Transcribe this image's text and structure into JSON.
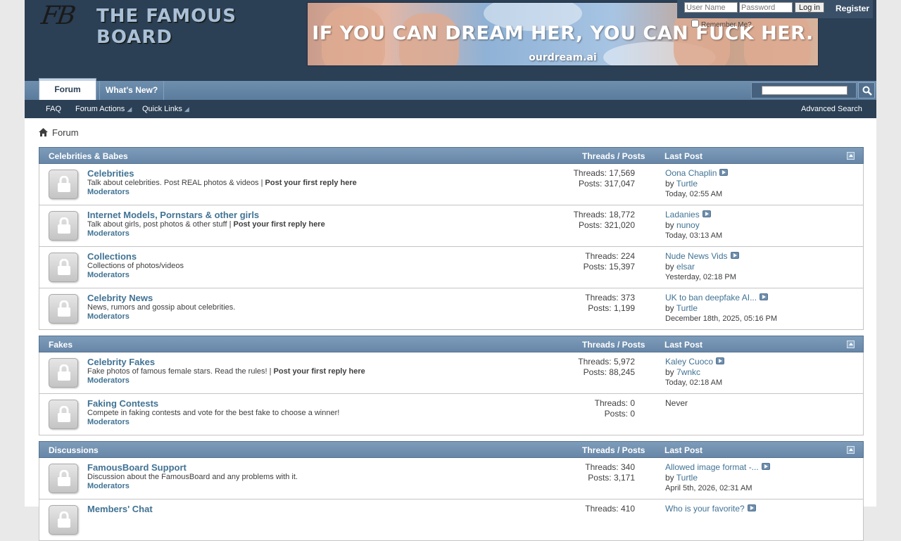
{
  "header": {
    "logo_mark": "FB",
    "logo_text": "THE FAMOUS BOARD",
    "banner_headline": "IF YOU CAN DREAM HER, YOU CAN FUCK HER.",
    "banner_domain": "ourdream.ai"
  },
  "login": {
    "username_placeholder": "User Name",
    "password_placeholder": "Password",
    "login_button": "Log in",
    "register": "Register",
    "remember_me": "Remember Me?"
  },
  "nav": {
    "tabs": [
      "Forum",
      "What's New?"
    ],
    "sub_links": [
      "FAQ",
      "Forum Actions",
      "Quick Links"
    ],
    "advanced_search": "Advanced Search"
  },
  "breadcrumb": "Forum",
  "categories": [
    {
      "title": "Celebrities & Babes",
      "threads_posts": "Threads / Posts",
      "last_post": "Last Post",
      "forums": [
        {
          "title": "Celebrities",
          "desc": "Talk about celebrities. Post REAL photos & videos | ",
          "desc_bold": "Post your first reply here",
          "mods": "Moderators",
          "threads": "Threads: 17,569",
          "posts": "Posts: 317,047",
          "lp_title": "Oona Chaplin",
          "lp_by": "by ",
          "lp_user": "Turtle",
          "lp_date": "Today, ",
          "lp_time": "02:55 AM"
        },
        {
          "title": "Internet Models, Pornstars & other girls",
          "desc": "Talk about girls, post photos & other stuff | ",
          "desc_bold": "Post your first reply here",
          "mods": "Moderators",
          "threads": "Threads: 18,772",
          "posts": "Posts: 321,020",
          "lp_title": "Ladanies",
          "lp_by": "by ",
          "lp_user": "nunoy",
          "lp_date": "Today, ",
          "lp_time": "03:13 AM"
        },
        {
          "title": "Collections",
          "desc": "Collections of photos/videos",
          "desc_bold": "",
          "mods": "Moderators",
          "threads": "Threads: 224",
          "posts": "Posts: 15,397",
          "lp_title": "Nude News Vids",
          "lp_by": "by ",
          "lp_user": "elsar",
          "lp_date": "Yesterday, ",
          "lp_time": "02:18 PM"
        },
        {
          "title": "Celebrity News",
          "desc": "News, rumors and gossip about celebrities.",
          "desc_bold": "",
          "mods": "Moderators",
          "threads": "Threads: 373",
          "posts": "Posts: 1,199",
          "lp_title": "UK to ban deepfake AI...",
          "lp_by": "by ",
          "lp_user": "Turtle",
          "lp_date": "December 18th, 2025, ",
          "lp_time": "05:16 PM"
        }
      ]
    },
    {
      "title": "Fakes",
      "threads_posts": "Threads / Posts",
      "last_post": "Last Post",
      "forums": [
        {
          "title": "Celebrity Fakes",
          "desc": "Fake photos of famous female stars. Read the rules! | ",
          "desc_bold": "Post your first reply here",
          "mods": "Moderators",
          "threads": "Threads: 5,972",
          "posts": "Posts: 88,245",
          "lp_title": "Kaley Cuoco",
          "lp_by": "by ",
          "lp_user": "7wnkc",
          "lp_date": "Today, ",
          "lp_time": "02:18 AM"
        },
        {
          "title": "Faking Contests",
          "desc": "Compete in faking contests and vote for the best fake to choose a winner!",
          "desc_bold": "",
          "mods": "Moderators",
          "threads": "Threads: 0",
          "posts": "Posts: 0",
          "never": "Never"
        }
      ]
    },
    {
      "title": "Discussions",
      "threads_posts": "Threads / Posts",
      "last_post": "Last Post",
      "forums": [
        {
          "title": "FamousBoard Support",
          "desc": "Discussion about the FamousBoard and any problems with it.",
          "desc_bold": "",
          "mods": "Moderators",
          "threads": "Threads: 340",
          "posts": "Posts: 3,171",
          "lp_title": "Allowed image format -...",
          "lp_by": "by ",
          "lp_user": "Turtle",
          "lp_date": "April 5th, 2026, ",
          "lp_time": "02:31 AM"
        },
        {
          "title": "Members' Chat",
          "desc": "",
          "desc_bold": "",
          "mods": "",
          "threads": "Threads: 410",
          "posts": "",
          "lp_title": "Who is your favorite?",
          "lp_by": "",
          "lp_user": "",
          "lp_date": "",
          "lp_time": ""
        }
      ]
    }
  ]
}
